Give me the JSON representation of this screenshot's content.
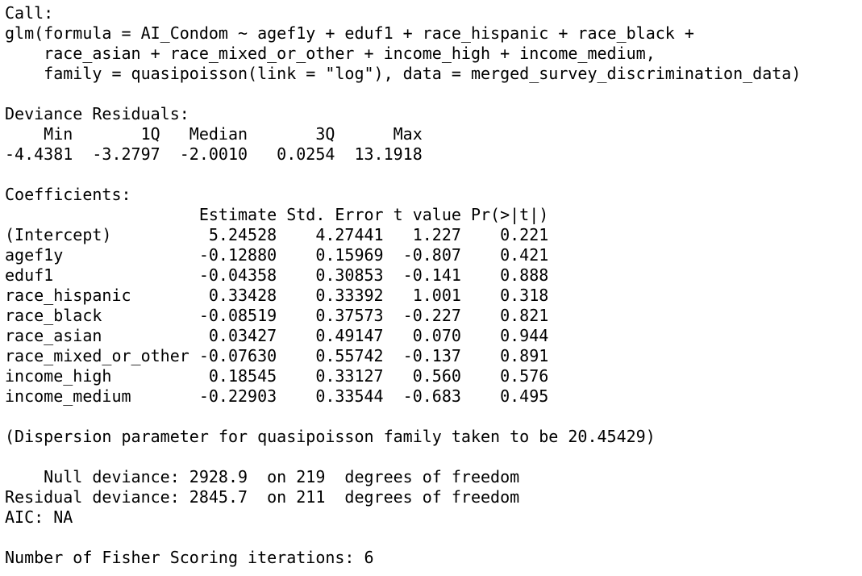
{
  "console": {
    "call_header": "Call:",
    "call_lines": [
      "glm(formula = AI_Condom ~ agef1y + eduf1 + race_hispanic + race_black + ",
      "    race_asian + race_mixed_or_other + income_high + income_medium, ",
      "    family = quasipoisson(link = \"log\"), data = merged_survey_discrimination_data)"
    ],
    "deviance_residuals": {
      "header": "Deviance Residuals: ",
      "labels_line": "    Min       1Q   Median       3Q      Max  ",
      "values_line": "-4.4381  -3.2797  -2.0010   0.0254  13.1918  ",
      "stats": {
        "Min": "-4.4381",
        "1Q": "-3.2797",
        "Median": "-2.0010",
        "3Q": "0.0254",
        "Max": "13.1918"
      }
    },
    "coefficients": {
      "header": "Coefficients:",
      "columns_line": "                    Estimate Std. Error t value Pr(>|t|)",
      "columns": [
        "Estimate",
        "Std. Error",
        "t value",
        "Pr(>|t|)"
      ],
      "rows": [
        {
          "name": "(Intercept)",
          "estimate": "5.24528",
          "std_error": "4.27441",
          "t_value": "1.227",
          "p_value": "0.221",
          "text": "(Intercept)          5.24528    4.27441   1.227    0.221"
        },
        {
          "name": "agef1y",
          "estimate": "-0.12880",
          "std_error": "0.15969",
          "t_value": "-0.807",
          "p_value": "0.421",
          "text": "agef1y              -0.12880    0.15969  -0.807    0.421"
        },
        {
          "name": "eduf1",
          "estimate": "-0.04358",
          "std_error": "0.30853",
          "t_value": "-0.141",
          "p_value": "0.888",
          "text": "eduf1               -0.04358    0.30853  -0.141    0.888"
        },
        {
          "name": "race_hispanic",
          "estimate": "0.33428",
          "std_error": "0.33392",
          "t_value": "1.001",
          "p_value": "0.318",
          "text": "race_hispanic        0.33428    0.33392   1.001    0.318"
        },
        {
          "name": "race_black",
          "estimate": "-0.08519",
          "std_error": "0.37573",
          "t_value": "-0.227",
          "p_value": "0.821",
          "text": "race_black          -0.08519    0.37573  -0.227    0.821"
        },
        {
          "name": "race_asian",
          "estimate": "0.03427",
          "std_error": "0.49147",
          "t_value": "0.070",
          "p_value": "0.944",
          "text": "race_asian           0.03427    0.49147   0.070    0.944"
        },
        {
          "name": "race_mixed_or_other",
          "estimate": "-0.07630",
          "std_error": "0.55742",
          "t_value": "-0.137",
          "p_value": "0.891",
          "text": "race_mixed_or_other -0.07630    0.55742  -0.137    0.891"
        },
        {
          "name": "income_high",
          "estimate": "0.18545",
          "std_error": "0.33127",
          "t_value": "0.560",
          "p_value": "0.576",
          "text": "income_high          0.18545    0.33127   0.560    0.576"
        },
        {
          "name": "income_medium",
          "estimate": "-0.22903",
          "std_error": "0.33544",
          "t_value": "-0.683",
          "p_value": "0.495",
          "text": "income_medium       -0.22903    0.33544  -0.683    0.495"
        }
      ]
    },
    "dispersion_line": "(Dispersion parameter for quasipoisson family taken to be 20.45429)",
    "null_deviance_line": "    Null deviance: 2928.9  on 219  degrees of freedom",
    "residual_deviance_line": "Residual deviance: 2845.7  on 211  degrees of freedom",
    "aic_line": "AIC: NA",
    "fisher_line": "Number of Fisher Scoring iterations: 6"
  }
}
